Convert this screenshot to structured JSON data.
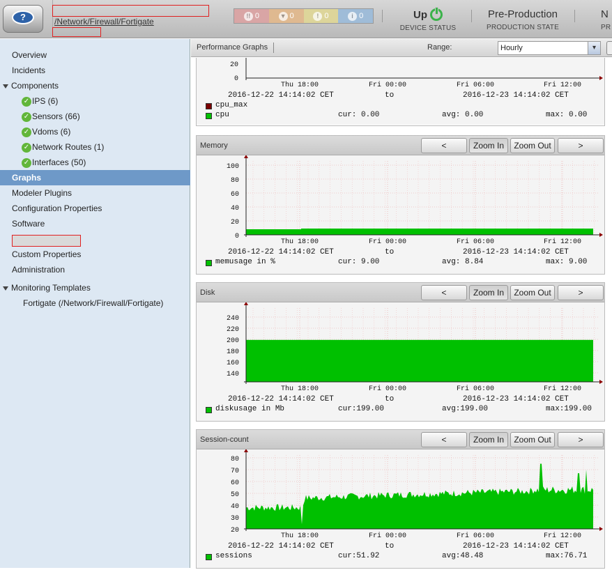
{
  "header": {
    "breadcrumb": "/Network/Firewall/Fortigate",
    "events": [
      {
        "severity": "critical",
        "count": "0",
        "color": "#d9a5a5"
      },
      {
        "severity": "error",
        "count": "0",
        "color": "#dfb990"
      },
      {
        "severity": "warning",
        "count": "0",
        "color": "#ddd59a"
      },
      {
        "severity": "info",
        "count": "0",
        "color": "#9fbcd8"
      }
    ],
    "device_status": {
      "value": "Up",
      "label": "DEVICE STATUS",
      "icon": "power-icon",
      "color": "#3bb24a"
    },
    "production_state": {
      "value": "Pre-Production",
      "label": "PRODUCTION STATE"
    },
    "next": {
      "value": "N",
      "label": "PR"
    }
  },
  "sidebar": {
    "overview": "Overview",
    "incidents": "Incidents",
    "components": "Components",
    "components_items": [
      "IPS (6)",
      "Sensors (66)",
      "Vdoms (6)",
      "Network Routes (1)",
      "Interfaces (50)"
    ],
    "graphs": "Graphs",
    "modeler_plugins": "Modeler Plugins",
    "configuration_properties": "Configuration Properties",
    "software": "Software",
    "custom_properties": "Custom Properties",
    "administration": "Administration",
    "monitoring_templates": "Monitoring Templates",
    "template_item": "Fortigate (/Network/Firewall/Fortigate)",
    "active_color": "#6e99c8"
  },
  "toolbar": {
    "title": "Performance Graphs",
    "range_label": "Range:",
    "range_value": "Hourly"
  },
  "buttons": {
    "prev": "<",
    "zoom_in": "Zoom In",
    "zoom_out": "Zoom Out",
    "next": ">"
  },
  "graphs": {
    "x_ticks": [
      "Thu 18:00",
      "Fri 00:00",
      "Fri 06:00",
      "Fri 12:00"
    ],
    "start": "2016-12-22 14:14:02 CET",
    "to": "to",
    "end": "2016-12-23 14:14:02 CET",
    "cpu": {
      "y_ticks": [
        "20",
        "0"
      ],
      "series": [
        {
          "name": "cpu_max",
          "color": "#7a0000"
        },
        {
          "name": "cpu",
          "color": "#00c000",
          "cur": "cur: 0.00",
          "avg": "avg: 0.00",
          "max": "max: 0.00"
        }
      ]
    },
    "memory": {
      "title": "Memory",
      "y_ticks": [
        "100",
        "80",
        "60",
        "40",
        "20",
        "0"
      ],
      "series": {
        "name": "memusage in %",
        "color": "#00c000",
        "cur": "cur: 9.00",
        "avg": "avg: 8.84",
        "max": "max: 9.00"
      }
    },
    "disk": {
      "title": "Disk",
      "y_ticks": [
        "240",
        "220",
        "200",
        "180",
        "160",
        "140"
      ],
      "series": {
        "name": "diskusage in Mb",
        "color": "#00c000",
        "cur": "cur:199.00",
        "avg": "avg:199.00",
        "max": "max:199.00"
      }
    },
    "sessions": {
      "title": "Session-count",
      "y_ticks": [
        "80",
        "70",
        "60",
        "50",
        "40",
        "30",
        "20"
      ],
      "series": {
        "name": "sessions",
        "color": "#00c000",
        "cur": "cur:51.92",
        "avg": "avg:48.48",
        "max": "max:76.71"
      }
    }
  }
}
